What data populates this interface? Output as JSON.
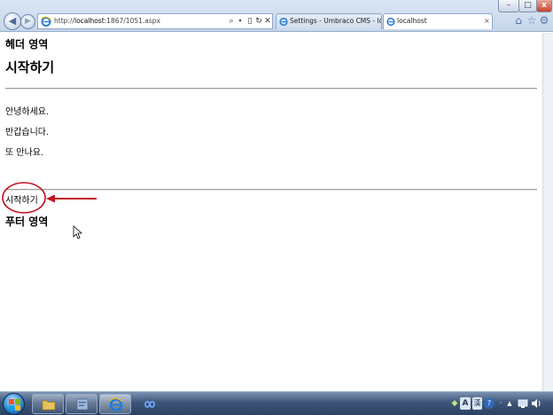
{
  "browser": {
    "address": {
      "prefix": "http://",
      "host": "localhost",
      "rest": ":1867/1051.aspx"
    },
    "address_icons": {
      "search": "⌕",
      "dropdown": "▾",
      "compat": "▯",
      "refresh": "↻",
      "stop": "✕"
    },
    "tabs": [
      {
        "label": "Settings - Umbraco CMS - lo..."
      },
      {
        "label": "localhost",
        "close": "×"
      }
    ],
    "window_controls": {
      "minimize": "–",
      "maximize": "□",
      "close": "x"
    },
    "toolbar_icons": {
      "home": "⌂",
      "favorites": "☆",
      "tools": "⚙"
    },
    "nav": {
      "back": "◀",
      "forward": "▶"
    }
  },
  "page": {
    "header_area": "헤더 영역",
    "title": "시작하기",
    "paragraphs": [
      "안녕하세요.",
      "반갑습니다.",
      "또 만나요."
    ],
    "start_link": "시작하기",
    "footer_area": "푸터 영역"
  },
  "annotation": {
    "color": "#c0111f"
  },
  "tray": {
    "lang": "A",
    "han": "漢",
    "help": "?",
    "up_arrow": "▲",
    "dot": "·"
  }
}
